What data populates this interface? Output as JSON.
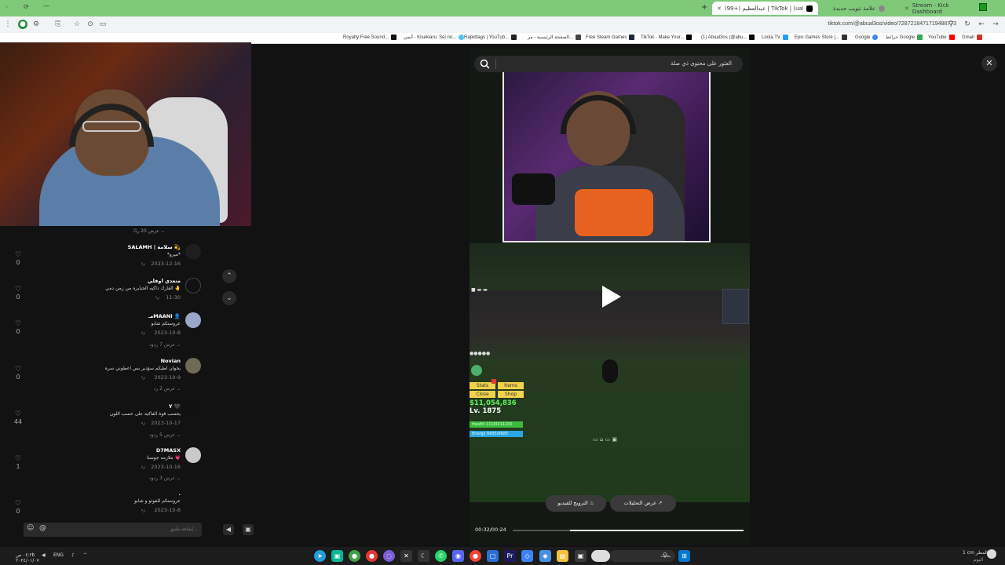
{
  "browser": {
    "tabs": [
      {
        "label": "Stream - Kick Dashboard",
        "color": "#53fc18"
      },
      {
        "label": "علامة تبويب جديدة",
        "color": "#888888"
      },
      {
        "label": "(99+) عبدالعظيم | TikTok | (ual3os)",
        "color": "#000000"
      }
    ],
    "url": "tiktok.com/@abual3os/video/7287218471719488773",
    "bookmarks": [
      "Gmail",
      "YouTube",
      "خرائط Google",
      "Google",
      "Epic Games Store |...",
      "Loola TV",
      "(1) Abual3os (@abu...",
      "TikTok - Make Your...",
      "Free Steam Games",
      "الصفحة الرئيسية - مر...",
      "Rapidtags | YouTub...",
      "أنمي - Kisekiaru: Sei no...",
      "Royalty Free Sound..."
    ]
  },
  "comments": {
    "show_more_top": "عرض 20 ردًا",
    "items": [
      {
        "name": "SALAMH | سلامة 💫",
        "text": "*ميرو*",
        "date": "2023-12-16",
        "reply": "رد",
        "likes": "0",
        "more": ""
      },
      {
        "name": "متعدي اوفلي",
        "text": "الفارك ذاكيه الجبابره من زمن دمي 🤚",
        "date": "11-30",
        "reply": "رد",
        "likes": "0",
        "more": ""
      },
      {
        "name": "مـMAANI 👤",
        "text": "عروستكم شابو",
        "date": "2023-10-8",
        "reply": "رد",
        "likes": "0",
        "more": "عرض 7 ردود"
      },
      {
        "name": "Novian",
        "text": "يخوان اطيكم سؤدير بس اعطوني سره",
        "date": "2023-10-9",
        "reply": "رد",
        "likes": "0",
        "more": "عرض 2 رد"
      },
      {
        "name": "Y 🖤",
        "text": "يحسب قوة الفاكية على حسب اللون",
        "date": "2023-10-17",
        "reply": "رد",
        "likes": "44",
        "more": "عرض 5 ردود"
      },
      {
        "name": "D7MASX",
        "text": "ملازمه جوستا 💗",
        "date": "2023-10-16",
        "reply": "رد",
        "likes": "1",
        "more": "عرض 3 ردود"
      },
      {
        "name": ".",
        "text": "عروستكم للفوتو و شابو",
        "date": "2023-10-8",
        "reply": "رد",
        "likes": "0",
        "more": ""
      }
    ],
    "input_placeholder": "إضافة تعليق..."
  },
  "video": {
    "search_placeholder": "العثور على محتوى ذي صلة",
    "hud": {
      "stats": "Stats",
      "items": "Items",
      "close": "Close",
      "shop": "Shop",
      "money": "$11,054,836",
      "level": "Lv. 1875",
      "health": "Health 11100/11100",
      "energy": "Energy 6685/6685"
    },
    "promote_label": "الترويج للفيديو",
    "analytics_label": "عرض التحليلات",
    "time": "00:32/00:24",
    "progress": 0.75
  },
  "taskbar": {
    "search": "بحث",
    "lang": "ENG",
    "clock_time": "٠٤:٢٥ ص",
    "clock_date": "٢٠٢٤/٠١/٠٧",
    "weather": "1 cm المطر",
    "weather_sub": "اليوم"
  }
}
